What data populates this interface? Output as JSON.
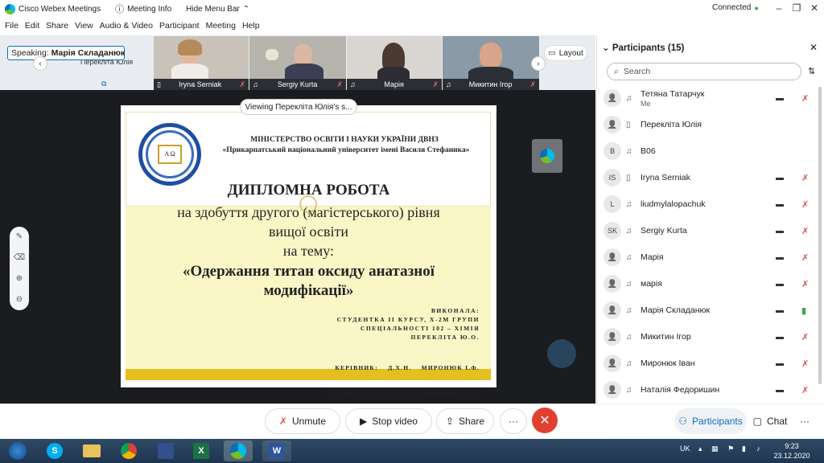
{
  "window": {
    "app_title": "Cisco Webex Meetings",
    "meeting_info": "Meeting Info",
    "hide_menu": "Hide Menu Bar",
    "status": "Connected"
  },
  "menu": [
    "File",
    "Edit",
    "Share",
    "View",
    "Audio & Video",
    "Participant",
    "Meeting",
    "Help"
  ],
  "speaking": {
    "label": "Speaking:",
    "name": "Марія Складанюк"
  },
  "strip": {
    "presenter_name": "Перекліта Юлія",
    "tiles": [
      {
        "name": "Iryna Serniak"
      },
      {
        "name": "Sergiy Kurta"
      },
      {
        "name": "Марія"
      },
      {
        "name": "Микитин Ігор"
      }
    ],
    "layout_label": "Layout"
  },
  "stage": {
    "viewing_label": "Viewing Перекліта Юлія's s..."
  },
  "slide": {
    "ministry_line1": "МІНІСТЕРСТВО ОСВІТИ І НАУКИ УКРАЇНИ ДВНЗ",
    "ministry_line2": "«Прикарпатський національний університет імені Василя Стефаника»",
    "logo_letters": "Α Ω",
    "title": "ДИПЛОМНА РОБОТА",
    "degree_line1": "на здобуття другого (магістерського) рівня",
    "degree_line2": "вищої освіти",
    "topic_intro": "на тему:",
    "topic_line1": "«Одержання титан оксиду анатазної",
    "topic_line2": "модифікації»",
    "author_line1": "ВИКОНАЛА:",
    "author_line2": "СТУДЕНТКА ІІ КУРСУ, Х-2М ГРУПИ",
    "author_line3": "СПЕЦІАЛЬНОСТІ 102 – ХІМІЯ",
    "author_line4": "ПЕРЕКЛІТА Ю.О.",
    "supervisor": "КЕРІВНИК:    Д.Х.Н.    МИРОНЮК І.Ф.",
    "reviewer": "РЕЦЕНЗЕНТ:   К.Т.Н.    МИКИТИН І.М."
  },
  "controls": {
    "unmute": "Unmute",
    "stop_video": "Stop video",
    "share": "Share",
    "more": "···",
    "participants": "Participants",
    "chat": "Chat"
  },
  "panel": {
    "title": "Participants (15)",
    "search_placeholder": "Search",
    "participants": [
      {
        "initials": "",
        "name": "Тетяна Татарчук",
        "sub": "Me",
        "device": "headset",
        "video": true,
        "mic": "muted"
      },
      {
        "initials": "",
        "name": "Перекліта Юлія",
        "sub": "",
        "device": "phone",
        "video": false,
        "mic": "none"
      },
      {
        "initials": "B",
        "name": "B06",
        "sub": "",
        "device": "headset",
        "video": false,
        "mic": "none"
      },
      {
        "initials": "IS",
        "name": "Iryna Serniak",
        "sub": "",
        "device": "phone",
        "video": true,
        "mic": "muted"
      },
      {
        "initials": "L",
        "name": "liudmylalopachuk",
        "sub": "",
        "device": "headset",
        "video": true,
        "mic": "muted"
      },
      {
        "initials": "SK",
        "name": "Sergiy Kurta",
        "sub": "",
        "device": "headset",
        "video": true,
        "mic": "muted"
      },
      {
        "initials": "",
        "name": "Марія",
        "sub": "",
        "device": "headset",
        "video": true,
        "mic": "muted"
      },
      {
        "initials": "",
        "name": "марія",
        "sub": "",
        "device": "headset",
        "video": true,
        "mic": "muted"
      },
      {
        "initials": "",
        "name": "Марія Складанюк",
        "sub": "",
        "device": "headset",
        "video": true,
        "mic": "active"
      },
      {
        "initials": "",
        "name": "Микитин Ігор",
        "sub": "",
        "device": "headset",
        "video": true,
        "mic": "muted"
      },
      {
        "initials": "",
        "name": "Миронюк Іван",
        "sub": "",
        "device": "headset",
        "video": true,
        "mic": "muted"
      },
      {
        "initials": "",
        "name": "Наталія Федоришин",
        "sub": "",
        "device": "headset",
        "video": true,
        "mic": "muted"
      }
    ]
  },
  "taskbar": {
    "lang": "UK",
    "time": "9:23",
    "date": "23.12.2020"
  },
  "colors": {
    "accent": "#0b6fb8",
    "end_call": "#e0412f",
    "slide_yellow": "#fbf6c6",
    "slide_bar": "#e3c020",
    "muted_red": "#d9534f",
    "active_green": "#39a845"
  }
}
